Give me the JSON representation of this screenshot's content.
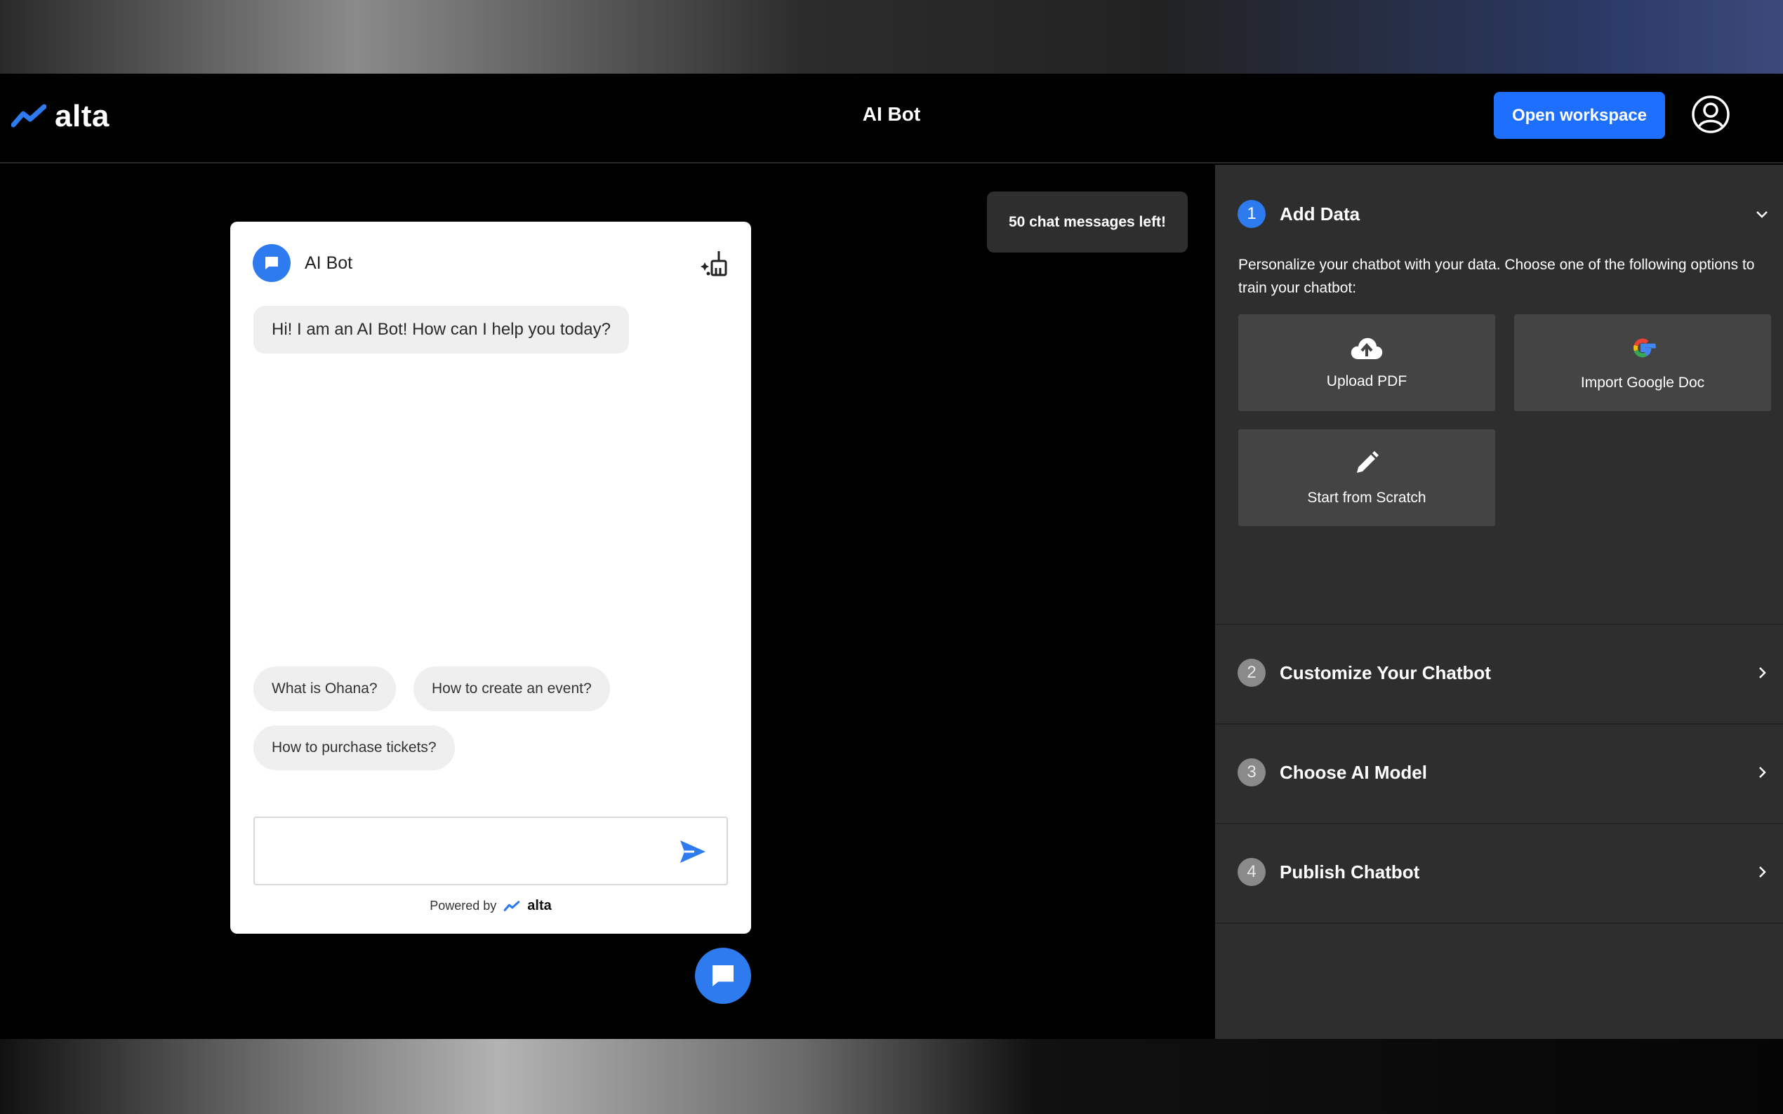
{
  "header": {
    "logo_text": "alta",
    "title": "AI Bot",
    "open_workspace": "Open workspace",
    "brand_color": "#1f6fff"
  },
  "status": {
    "messages_left": "50 chat messages left!"
  },
  "chat": {
    "bot_name": "AI Bot",
    "greeting": "Hi! I am an AI Bot! How can I help you today?",
    "suggestions": [
      "What is Ohana?",
      "How to create an event?",
      "How to purchase tickets?"
    ],
    "input_placeholder": "",
    "powered_by": "Powered by",
    "powered_brand": "alta"
  },
  "panel": {
    "steps": [
      {
        "number": "1",
        "title": "Add Data"
      },
      {
        "number": "2",
        "title": "Customize Your Chatbot"
      },
      {
        "number": "3",
        "title": "Choose AI Model"
      },
      {
        "number": "4",
        "title": "Publish Chatbot"
      }
    ],
    "add_data_description": "Personalize your chatbot with your data. Choose one of the following options to train your chatbot:",
    "options": [
      {
        "label": "Upload PDF",
        "icon": "cloud-upload-icon"
      },
      {
        "label": "Import Google Doc",
        "icon": "google-icon"
      },
      {
        "label": "Start from Scratch",
        "icon": "pencil-icon"
      }
    ]
  }
}
